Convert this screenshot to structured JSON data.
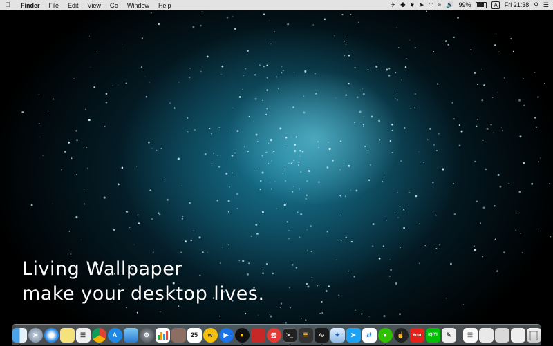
{
  "menubar": {
    "app_name": "Finder",
    "menus": [
      "File",
      "Edit",
      "View",
      "Go",
      "Window",
      "Help"
    ],
    "battery_percent": "99%",
    "input_source": "A",
    "clock": "Fri 21:38"
  },
  "desktop": {
    "caption_line1": "Living Wallpaper",
    "caption_line2": "make your desktop lives."
  },
  "dock": {
    "calendar_day": "25",
    "netease_badge": "云",
    "youtube_label": "You",
    "iqiyi_label": "iQIYI"
  }
}
